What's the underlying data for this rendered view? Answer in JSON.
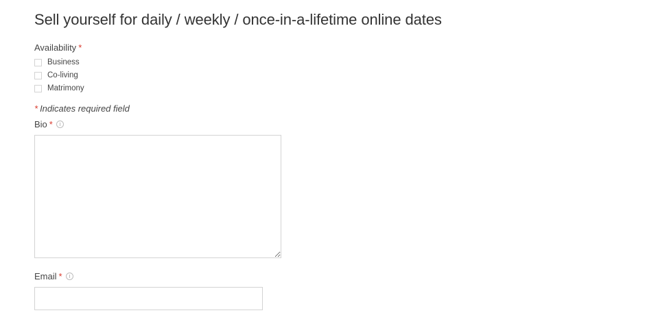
{
  "form": {
    "title": "Sell yourself for daily / weekly / once-in-a-lifetime online dates",
    "required_marker": "*",
    "availability": {
      "label": "Availability",
      "options": [
        {
          "label": "Business",
          "checked": false
        },
        {
          "label": "Co-living",
          "checked": false
        },
        {
          "label": "Matrimony",
          "checked": false
        }
      ]
    },
    "required_note": "Indicates required field",
    "bio": {
      "label": "Bio",
      "value": "",
      "help_icon": "help-circle-icon"
    },
    "email": {
      "label": "Email",
      "value": "",
      "help_icon": "help-circle-icon"
    }
  },
  "colors": {
    "required": "#d9392c",
    "text": "#333333",
    "border": "#d3d3d3"
  }
}
